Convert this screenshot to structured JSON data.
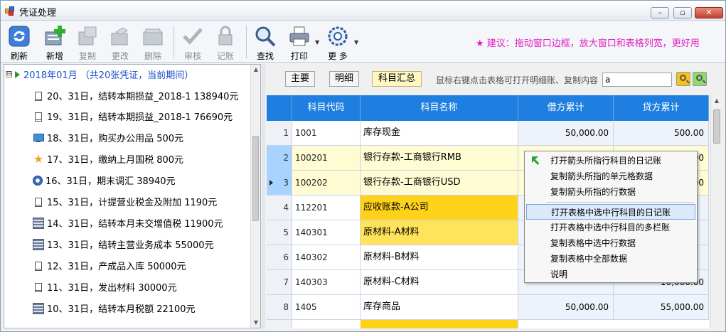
{
  "window": {
    "title": "凭证处理",
    "minimize": "–",
    "restore": "▫",
    "close": "✕"
  },
  "toolbar": {
    "buttons": [
      {
        "label": "刷新",
        "icon": "refresh-icon",
        "enabled": true
      },
      {
        "label": "新增",
        "icon": "add-icon",
        "enabled": true
      },
      {
        "label": "复制",
        "icon": "copy-icon",
        "enabled": false
      },
      {
        "label": "更改",
        "icon": "edit-icon",
        "enabled": false
      },
      {
        "label": "删除",
        "icon": "delete-icon",
        "enabled": false
      },
      {
        "label": "审核",
        "icon": "check-icon",
        "enabled": false
      },
      {
        "label": "记账",
        "icon": "lock-icon",
        "enabled": false
      },
      {
        "label": "查找",
        "icon": "search-icon",
        "enabled": true
      },
      {
        "label": "打印",
        "icon": "print-icon",
        "enabled": true
      },
      {
        "label": "更 多",
        "icon": "gear-icon",
        "enabled": true
      }
    ],
    "suggestion": "★ 建议：拖动窗口边框，放大窗口和表格列宽，更好用"
  },
  "tree": {
    "expander": "⊟",
    "root_label": "2018年01月 （共20张凭证，当前期间）",
    "items": [
      {
        "text": "20、31日，结转本期损益_2018-1 138940元",
        "icon": "doc-icon"
      },
      {
        "text": "19、31日，结转本期损益_2018-1 76690元",
        "icon": "doc-icon"
      },
      {
        "text": "18、31日，购买办公用品 500元",
        "icon": "monitor-icon"
      },
      {
        "text": "17、31日，缴纳上月国税 800元",
        "icon": "star-icon"
      },
      {
        "text": "16、31日，期末调汇 38940元",
        "icon": "clock-icon"
      },
      {
        "text": "15、31日，计提营业税金及附加 1190元",
        "icon": "doc-icon"
      },
      {
        "text": "14、31日，结转本月未交增值税 11900元",
        "icon": "calc-icon"
      },
      {
        "text": "13、31日，结转主营业务成本 55000元",
        "icon": "calc-icon"
      },
      {
        "text": "12、31日，产成品入库 50000元",
        "icon": "doc-icon"
      },
      {
        "text": "11、31日，发出材料 30000元",
        "icon": "doc-icon"
      },
      {
        "text": "10、31日，结转本月税额 22100元",
        "icon": "calc-icon"
      }
    ]
  },
  "right": {
    "tabs": [
      "主要",
      "明细",
      "科目汇总"
    ],
    "active_tab": 2,
    "hint": "鼠标右键点击表格可打开明细账、复制内容",
    "search_value": "a",
    "grid": {
      "columns": [
        "",
        "科目代码",
        "科目名称",
        "借方累计",
        "贷方累计"
      ],
      "rows": [
        {
          "num": "1",
          "code": "1001",
          "name": "库存现金",
          "debit": "50,000.00",
          "credit": "500.00",
          "style": "white"
        },
        {
          "num": "2",
          "code": "100201",
          "name": "银行存款-工商银行RMB",
          "debit": "",
          "credit": "00",
          "style": "yellow"
        },
        {
          "num": "3",
          "code": "100202",
          "name": "银行存款-工商银行USD",
          "debit": "",
          "credit": "00",
          "style": "yellow"
        },
        {
          "num": "4",
          "code": "112201",
          "name": "应收账款-A公司",
          "debit": "",
          "credit": "",
          "style": "gold"
        },
        {
          "num": "5",
          "code": "140301",
          "name": "原材料-A材料",
          "debit": "",
          "credit": "",
          "style": "gold-light"
        },
        {
          "num": "6",
          "code": "140302",
          "name": "原材料-B材料",
          "debit": "",
          "credit": "",
          "style": "white"
        },
        {
          "num": "7",
          "code": "140303",
          "name": "原材料-C材料",
          "debit": "",
          "credit": "10,000.00",
          "style": "white"
        },
        {
          "num": "8",
          "code": "1405",
          "name": "库存商品",
          "debit": "50,000.00",
          "credit": "55,000.00",
          "style": "white"
        }
      ]
    }
  },
  "context_menu": {
    "items": [
      "打开箭头所指行科目的日记账",
      "复制箭头所指的单元格数据",
      "复制箭头所指的行数据",
      "打开表格中选中行科目的日记账",
      "打开表格中选中行科目的多栏账",
      "复制表格中选中行数据",
      "复制表格中全部数据",
      "说明"
    ],
    "highlighted": 3
  }
}
